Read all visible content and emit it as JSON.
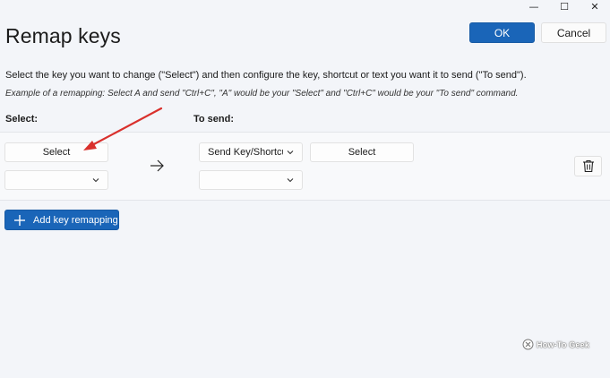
{
  "window": {
    "minimize_glyph": "—",
    "maximize_glyph": "☐",
    "close_glyph": "✕"
  },
  "header": {
    "title": "Remap keys",
    "ok_label": "OK",
    "cancel_label": "Cancel"
  },
  "instructions": {
    "main": "Select the key you want to change (\"Select\") and then configure the key, shortcut or text you want it to send (\"To send\").",
    "example": "Example of a remapping: Select A and send \"Ctrl+C\", \"A\" would be your \"Select\" and \"Ctrl+C\" would be your \"To send\" command."
  },
  "columns": {
    "select_label": "Select:",
    "to_send_label": "To send:"
  },
  "row": {
    "select_button_label": "Select",
    "select_dropdown_value": "",
    "send_type_value": "Send Key/Shortcu",
    "send_select_button_label": "Select",
    "send_dropdown_value": ""
  },
  "actions": {
    "add_remapping_label": "Add key remapping"
  },
  "watermark": {
    "text": "How-To Geek"
  },
  "colors": {
    "accent": "#1a65b8",
    "background": "#f3f5f9",
    "annotation_arrow": "#d9302c"
  },
  "icons": {
    "arrow": "arrow-right-icon",
    "delete": "trash-icon",
    "add": "plus-icon",
    "dropdown": "chevron-down-icon"
  }
}
